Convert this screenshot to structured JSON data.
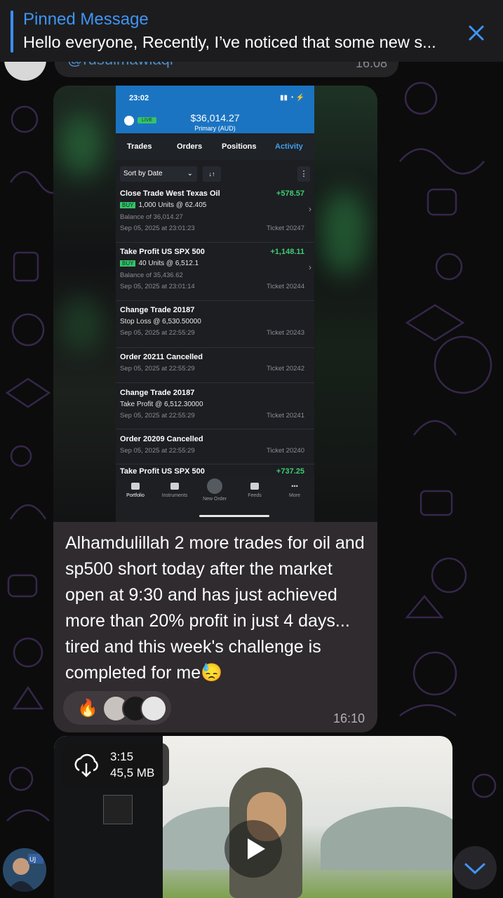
{
  "pinned": {
    "title": "Pinned Message",
    "text": "Hello everyone, Recently, I’ve noticed that some new s..."
  },
  "prev_message": {
    "handle": "@rusulmawlaqi",
    "time": "16:08"
  },
  "trade_app": {
    "status_time": "23:02",
    "live_badge": "LIVE",
    "balance": "$36,014.27",
    "account": "Primary (AUD)",
    "tabs": [
      "Trades",
      "Orders",
      "Positions",
      "Activity"
    ],
    "active_tab": "Activity",
    "sort_label": "Sort by Date",
    "sort_dir": "↓↑",
    "items": [
      {
        "title": "Close Trade West Texas Oil",
        "amount": "+578.57",
        "buy": "BUY",
        "detail": "1,000 Units @ 62.405",
        "balance": "Balance of 36,014.27",
        "date": "Sep 05, 2025 at 23:01:23",
        "ticket": "Ticket 20247"
      },
      {
        "title": "Take Profit US SPX 500",
        "amount": "+1,148.11",
        "buy": "BUY",
        "detail": "40 Units @ 6,512.1",
        "balance": "Balance of 35,436.62",
        "date": "Sep 05, 2025 at 23:01:14",
        "ticket": "Ticket 20244"
      },
      {
        "title": "Change Trade 20187",
        "detail": "Stop Loss @ 6,530.50000",
        "date": "Sep 05, 2025 at 22:55:29",
        "ticket": "Ticket 20243"
      },
      {
        "title": "Order 20211 Cancelled",
        "date": "Sep 05, 2025 at 22:55:29",
        "ticket": "Ticket 20242"
      },
      {
        "title": "Change Trade 20187",
        "detail": "Take Profit @ 6,512.30000",
        "date": "Sep 05, 2025 at 22:55:29",
        "ticket": "Ticket 20241"
      },
      {
        "title": "Order 20209 Cancelled",
        "date": "Sep 05, 2025 at 22:55:29",
        "ticket": "Ticket 20240"
      },
      {
        "title": "Take Profit US SPX 500",
        "amount": "+737.25"
      }
    ],
    "nav": [
      "Portfolio",
      "Instruments",
      "New Order",
      "Feeds",
      "More"
    ]
  },
  "message": {
    "caption": "Alhamdulillah 2 more trades for oil and sp500 short today after the market open at 9:30  and has just achieved more than 20% profit in just 4 days... tired and this week's challenge is completed for me😓",
    "reaction_emoji": "🔥",
    "time": "16:10"
  },
  "video": {
    "duration": "3:15",
    "size": "45,5 MB"
  },
  "colors": {
    "accent": "#3e95f4",
    "profit": "#3ecd73",
    "app_header": "#1b74c2"
  }
}
